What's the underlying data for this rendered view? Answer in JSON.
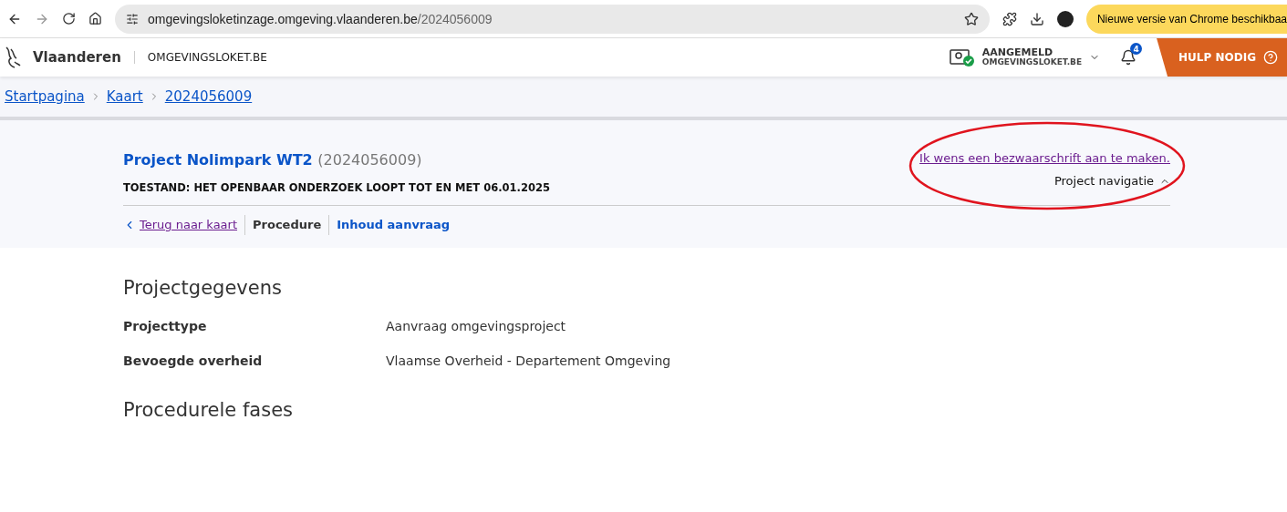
{
  "browser": {
    "url_host": "omgevingsloketinzage.omgeving.vlaanderen.be",
    "url_path": "/2024056009",
    "update_label": "Nieuwe versie van Chrome beschikbaa"
  },
  "header": {
    "brand": "Vlaanderen",
    "site": "OMGEVINGSLOKET.BE",
    "account_status": "AANGEMELD",
    "account_site": "OMGEVINGSLOKET.BE",
    "notification_count": "4",
    "help": "HULP NODIG"
  },
  "breadcrumb": [
    "Startpagina",
    "Kaart",
    "2024056009"
  ],
  "project": {
    "title": "Project Nolimpark WT2",
    "number": "(2024056009)",
    "status": "TOESTAND: HET OPENBAAR ONDERZOEK LOOPT TOT EN MET 06.01.2025",
    "objection_link": "Ik wens een bezwaarschrift aan te maken.",
    "navigation_toggle": "Project navigatie"
  },
  "nav": [
    {
      "label": "Terug naar kaart",
      "kind": "back",
      "selected": false
    },
    {
      "label": "Procedure",
      "kind": "tab",
      "selected": true
    },
    {
      "label": "Inhoud aanvraag",
      "kind": "tab",
      "selected": false
    }
  ],
  "sections": [
    {
      "heading": "Projectgegevens",
      "fields": [
        {
          "label": "Projecttype",
          "value": "Aanvraag omgevingsproject"
        },
        {
          "label": "Bevoegde overheid",
          "value": "Vlaamse Overheid - Departement Omgeving"
        }
      ]
    },
    {
      "heading": "Procedurele fases"
    }
  ]
}
